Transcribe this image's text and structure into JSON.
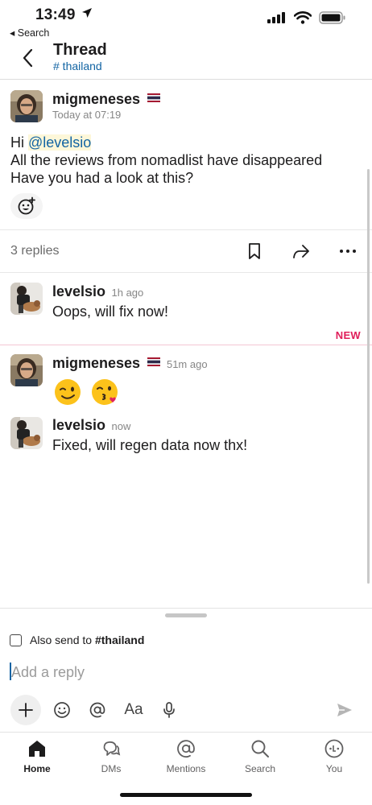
{
  "status_bar": {
    "time": "13:49",
    "back_app": "◂ Search"
  },
  "header": {
    "title": "Thread",
    "channel": "# thailand"
  },
  "parent_message": {
    "author": "migmeneses",
    "timestamp": "Today at 07:19",
    "greeting": "Hi ",
    "mention": "@levelsio",
    "line2": "All the reviews from nomadlist have disappeared",
    "line3": "Have you had a look at this?"
  },
  "thread_actions": {
    "replies_count": "3 replies",
    "icons": [
      "bookmark-icon",
      "share-icon",
      "more-icon"
    ]
  },
  "new_divider": {
    "label": "NEW"
  },
  "replies": [
    {
      "author": "levelsio",
      "time": "1h ago",
      "text": "Oops, will fix now!"
    },
    {
      "author": "migmeneses",
      "time": "51m ago",
      "emojis": [
        "wink-emoji",
        "kiss-emoji"
      ]
    },
    {
      "author": "levelsio",
      "time": "now",
      "text": "Fixed, will regen data now thx!"
    }
  ],
  "composer": {
    "also_send_prefix": "Also send to ",
    "also_send_channel": "#thailand",
    "placeholder": "Add a reply",
    "format_label": "Aa"
  },
  "tabs": [
    {
      "label": "Home",
      "active": true
    },
    {
      "label": "DMs"
    },
    {
      "label": "Mentions"
    },
    {
      "label": "Search"
    },
    {
      "label": "You"
    }
  ],
  "colors": {
    "link": "#1264a3",
    "new": "#e01e5a",
    "flag_red": "#a51931",
    "flag_blue": "#2d2a4a"
  }
}
